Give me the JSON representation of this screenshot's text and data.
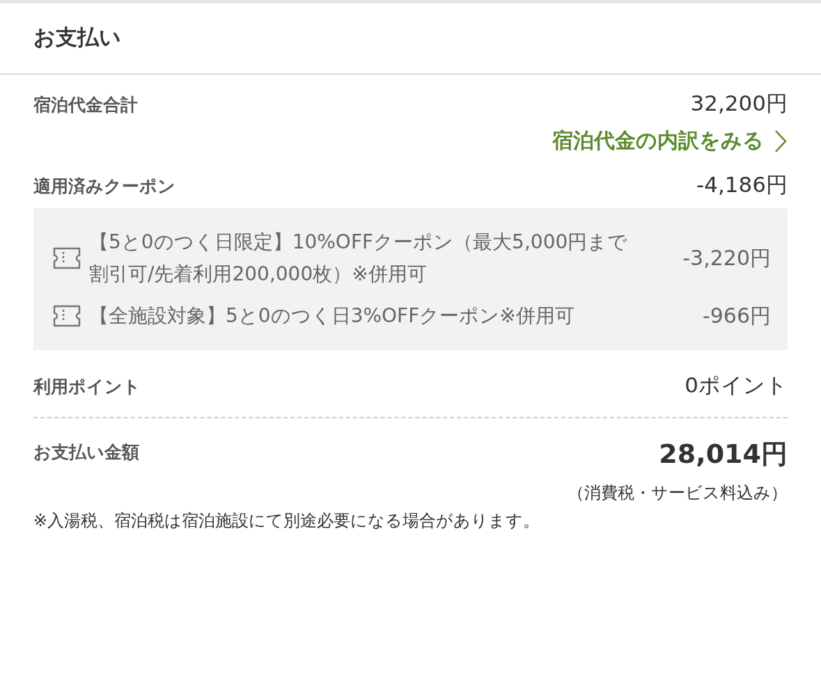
{
  "title": "お支払い",
  "stay_total": {
    "label": "宿泊代金合計",
    "amount": "32,200円"
  },
  "breakdown_link": {
    "label": "宿泊代金の内訳をみる"
  },
  "coupons": {
    "label": "適用済みクーポン",
    "amount": "-4,186円",
    "items": [
      {
        "name": "【5と0のつく日限定】10%OFFクーポン（最大5,000円まで割引可/先着利用200,000枚）※併用可",
        "amount": "-3,220円"
      },
      {
        "name": "【全施設対象】5と0のつく日3%OFFクーポン※併用可",
        "amount": "-966円"
      }
    ]
  },
  "points": {
    "label": "利用ポイント",
    "amount": "0ポイント"
  },
  "payment_total": {
    "label": "お支払い金額",
    "amount": "28,014円",
    "note": "（消費税・サービス料込み）"
  },
  "footnote": "※入湯税、宿泊税は宿泊施設にて別途必要になる場合があります。"
}
